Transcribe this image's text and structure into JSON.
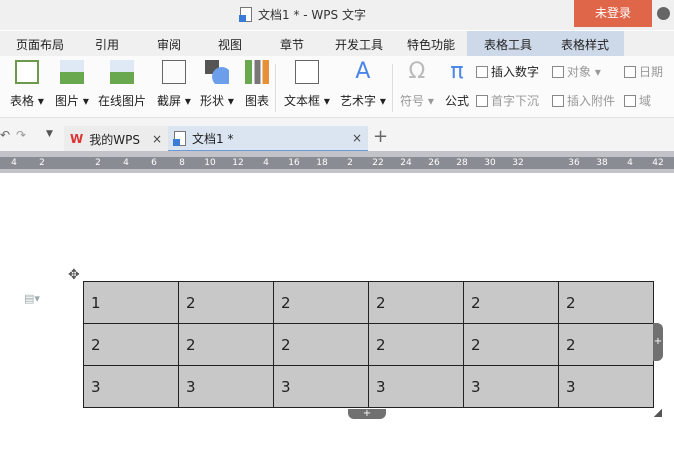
{
  "window": {
    "title": "文档1 * - WPS 文字",
    "login": "未登录"
  },
  "menu": [
    "页面布局",
    "引用",
    "审阅",
    "视图",
    "章节",
    "开发工具",
    "特色功能",
    "表格工具",
    "表格样式"
  ],
  "ribbon": {
    "big": [
      "表格 ▾",
      "图片 ▾",
      "在线图片",
      "截屏 ▾",
      "形状 ▾",
      "图表",
      "文本框 ▾",
      "艺术字 ▾",
      "符号 ▾",
      "公式"
    ],
    "small": [
      "插入数字",
      "对象 ▾",
      "日期",
      "首字下沉",
      "插入附件",
      "域"
    ]
  },
  "tabs": [
    {
      "label": "我的WPS"
    },
    {
      "label": "文档1 *"
    }
  ],
  "ruler": [
    "4",
    "2",
    "",
    "2",
    "4",
    "6",
    "8",
    "10",
    "12",
    "4",
    "16",
    "18",
    "2",
    "22",
    "24",
    "26",
    "28",
    "30",
    "32",
    "",
    "36",
    "38",
    "4",
    "42"
  ],
  "table": [
    [
      "1",
      "2",
      "2",
      "2",
      "2",
      "2"
    ],
    [
      "2",
      "2",
      "2",
      "2",
      "2",
      "2"
    ],
    [
      "3",
      "3",
      "3",
      "3",
      "3",
      "3"
    ]
  ],
  "colors": {
    "accent": "#e0664a",
    "table_fill": "#c8c8c8",
    "tab_active": "#dbe5f1"
  }
}
